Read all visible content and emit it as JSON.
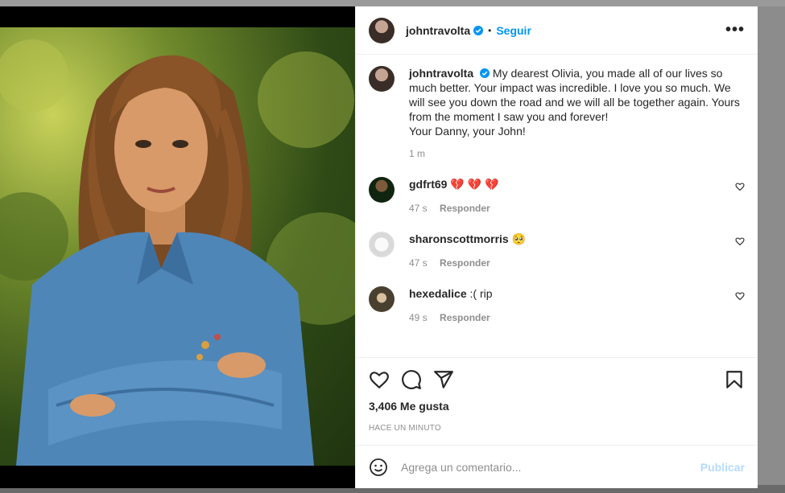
{
  "post": {
    "username": "johntravolta",
    "follow_label": "Seguir",
    "more_label": "•••",
    "dot": "•",
    "caption_text": "My dearest Olivia, you made all of our lives so much better. Your impact was incredible. I love you so much. We will see you down the road and we will all be together again. Yours from the moment I saw you and forever!",
    "caption_signoff": "Your Danny, your John!",
    "caption_time": "1 m",
    "likes": "3,406 Me gusta",
    "posted_ago": "HACE UN MINUTO"
  },
  "comments": [
    {
      "username": "gdfrt69",
      "text": "💔 💔 💔",
      "time": "47 s",
      "reply_label": "Responder"
    },
    {
      "username": "sharonscottmorris",
      "text": "🥺",
      "time": "47 s",
      "reply_label": "Responder"
    },
    {
      "username": "hexedalice",
      "text": ":( rip",
      "time": "49 s",
      "reply_label": "Responder"
    }
  ],
  "add_comment": {
    "placeholder": "Agrega un comentario...",
    "publish_label": "Publicar"
  },
  "icons": {
    "like": "heart-icon",
    "comment": "comment-icon",
    "share": "paper-plane-icon",
    "save": "bookmark-icon",
    "emoji": "smiley-icon",
    "verified": "verified-badge-icon"
  },
  "colors": {
    "accent": "#0095f6",
    "publish_disabled": "#b3dbff",
    "secondary_text": "#8e8e8e"
  }
}
